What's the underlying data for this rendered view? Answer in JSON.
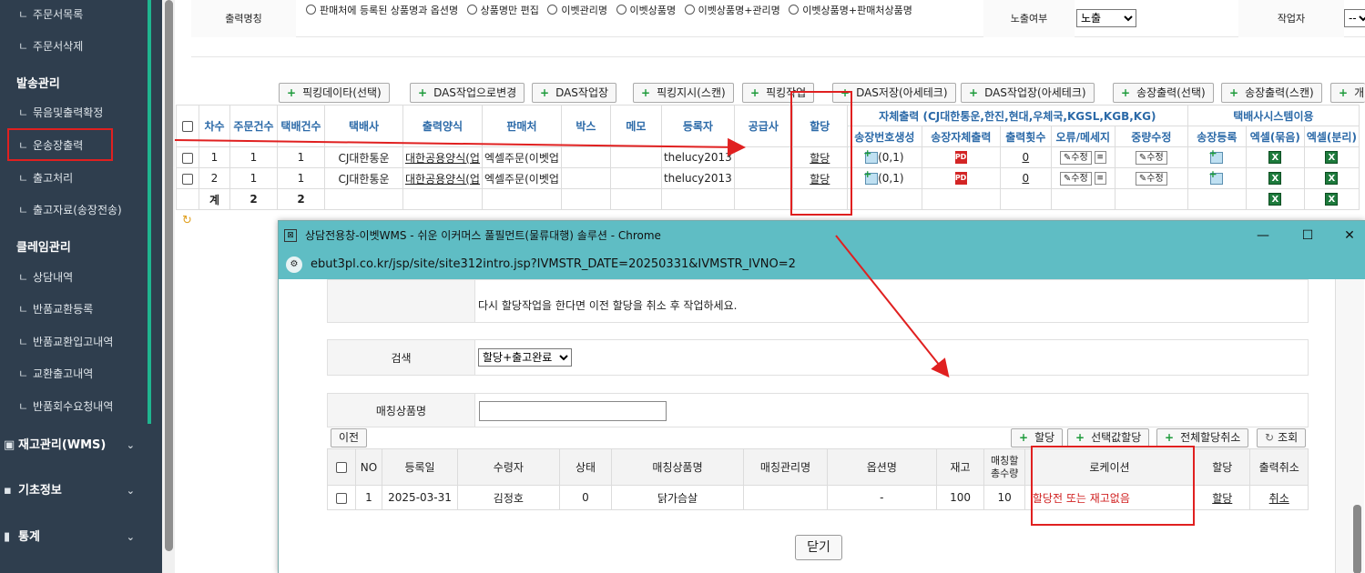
{
  "sidebar": {
    "items_top": [
      {
        "prefix": "ㄴ",
        "label": "주문서목록"
      },
      {
        "prefix": "ㄴ",
        "label": "주문서삭제"
      }
    ],
    "section_shipping": "발송관리",
    "items_shipping": [
      {
        "prefix": "ㄴ",
        "label": "묶음및출력확정"
      },
      {
        "prefix": "ㄴ",
        "label": "운송장출력"
      },
      {
        "prefix": "ㄴ",
        "label": "출고처리"
      },
      {
        "prefix": "ㄴ",
        "label": "출고자료(송장전송)"
      }
    ],
    "section_claim": "클레임관리",
    "items_claim": [
      {
        "prefix": "ㄴ",
        "label": "상담내역"
      },
      {
        "prefix": "ㄴ",
        "label": "반품교환등록"
      },
      {
        "prefix": "ㄴ",
        "label": "반품교환입고내역"
      },
      {
        "prefix": "ㄴ",
        "label": "교환출고내역"
      },
      {
        "prefix": "ㄴ",
        "label": "반품회수요청내역"
      }
    ],
    "collapsed_sections": [
      {
        "label": "재고관리(WMS)",
        "icon": "cubes-icon"
      },
      {
        "label": "기초정보",
        "icon": "info-icon"
      },
      {
        "label": "통계",
        "icon": "chart-icon"
      }
    ]
  },
  "top_form": {
    "label_print_name": "출력명칭",
    "radio_options": [
      "판매처에 등록된 상품명과 옵션명",
      "상품명만 편집",
      "이벳관리명",
      "이벳상품명",
      "이벳상품명+관리명",
      "이벳상품명+판매처상품명"
    ],
    "label_exposure": "노출여부",
    "exposure_value": "노출",
    "label_worker": "작업자",
    "worker_value": "--전"
  },
  "toolbar": {
    "buttons": [
      "픽킹데이타(선택)",
      "DAS작업으로변경",
      "DAS작업장",
      "픽킹지시(스캔)",
      "픽킹작업",
      "DAS저장(아세테크)",
      "DAS작업장(아세테크)",
      "송장출력(선택)",
      "송장출력(스캔)",
      "개별"
    ]
  },
  "main_table": {
    "headers": [
      "차수",
      "주문건수",
      "택배건수",
      "택배사",
      "출력양식",
      "판매처",
      "박스",
      "메모",
      "등록자",
      "공급사",
      "할당"
    ],
    "group_self": "자체출력 (CJ대한통운,한진,현대,우체국,KGSL,KGB,KG)",
    "group_courier": "택배사시스템이용",
    "sub_headers": [
      "송장번호생성",
      "송장자체출력",
      "출력횟수",
      "오류/메세지",
      "중량수정",
      "송장등록",
      "엑셀(묶음)",
      "엑셀(분리)"
    ],
    "rows": [
      {
        "round": "1",
        "orders": "1",
        "parcels": "1",
        "courier": "CJ대한통운",
        "form": "대한공용양식(업",
        "seller": "엑셀주문(이벳업",
        "box": "",
        "memo": "",
        "registrant": "thelucy2013",
        "supplier": "",
        "alloc": "할당",
        "gen": "(0,1)",
        "count": "0",
        "edit": "수정"
      },
      {
        "round": "2",
        "orders": "1",
        "parcels": "1",
        "courier": "CJ대한통운",
        "form": "대한공용양식(업",
        "seller": "엑셀주문(이벳업",
        "box": "",
        "memo": "",
        "registrant": "thelucy2013",
        "supplier": "",
        "alloc": "할당",
        "gen": "(0,1)",
        "count": "0",
        "edit": "수정"
      }
    ],
    "total_label": "계",
    "total_orders": "2",
    "total_parcels": "2",
    "refresh_icon": "refresh-icon"
  },
  "popup": {
    "title": "상담전용창-이벳WMS - 쉬운 이커머스 풀필먼트(물류대행) 솔루션 - Chrome",
    "url": "ebut3pl.co.kr/jsp/site/site312intro.jsp?IVMSTR_DATE=20250331&IVMSTR_IVNO=2",
    "notice": "다시 할당작업을 한다면 이전 할당을 취소 후 작업하세요.",
    "label_search": "검색",
    "search_value": "할당+출고완료",
    "label_match_name": "매칭상품명",
    "match_name_value": "",
    "btn_prev": "이전",
    "btn_alloc": "할당",
    "btn_alloc_selected": "선택값할당",
    "btn_cancel_all": "전체할당취소",
    "btn_query": "조회",
    "table_headers": [
      "NO",
      "등록일",
      "수령자",
      "상태",
      "매칭상품명",
      "매칭관리명",
      "옵션명",
      "재고",
      "매칭할총수량",
      "로케이션",
      "할당",
      "출력취소"
    ],
    "rows": [
      {
        "no": "1",
        "date": "2025-03-31",
        "recipient": "김정호",
        "status": "0",
        "product": "닭가슴살",
        "mgmt": "",
        "option": "-",
        "stock": "100",
        "qty": "10",
        "location": "할당전 또는 재고없음",
        "alloc": "할당",
        "cancel": "취소"
      }
    ],
    "btn_close": "닫기"
  },
  "colors": {
    "sidebar_bg": "#2f3e4e",
    "sidebar_accent": "#1fb58f",
    "popup_titlebar": "#5fbdc4",
    "annotation_red": "#e02020",
    "header_blue": "#2c6aa8"
  }
}
